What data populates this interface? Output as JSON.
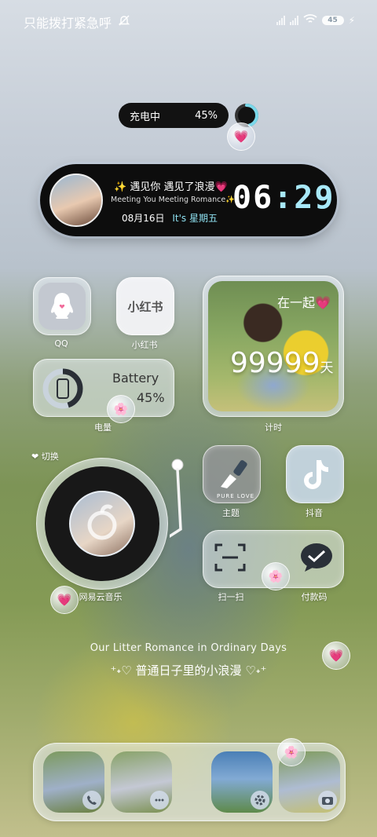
{
  "status": {
    "title": "只能拨打紧急呼",
    "battery": "45"
  },
  "charging": {
    "label": "充电中",
    "percent": "45%",
    "level": 0.45
  },
  "capsule": {
    "line1": "✨ 遇见你 遇见了浪漫💗",
    "line2": "Meeting You  Meeting Romance✨",
    "date": "08月16日",
    "weekday": "It's 星期五",
    "hour": "06",
    "colon": ":",
    "minute": "29"
  },
  "apps": {
    "qq": "QQ",
    "xhs_logo": "小红书",
    "xhs": "小红书",
    "timer": "计时",
    "battery_widget": "电量",
    "netease": "网易云音乐",
    "theme": "主题",
    "theme_caption": "PURE LOVE",
    "douyin": "抖音",
    "scan": "扫一扫",
    "pay": "付款码"
  },
  "photo_widget": {
    "together": "在一起💗",
    "count": "99999",
    "unit": "天"
  },
  "battery_widget": {
    "title": "Battery",
    "percent": "45%",
    "level": 0.45
  },
  "music": {
    "switch_label": "❤ 切换"
  },
  "slogan": {
    "english": "Our Litter Romance in Ordinary Days",
    "chinese": "⁺˖♡ 普通日子里的小浪漫 ♡˖⁺"
  },
  "dock": {
    "items": [
      {
        "icon": "phone-icon"
      },
      {
        "icon": "message-icon"
      },
      {
        "icon": "settings-icon"
      },
      {
        "icon": "camera-icon"
      }
    ]
  }
}
